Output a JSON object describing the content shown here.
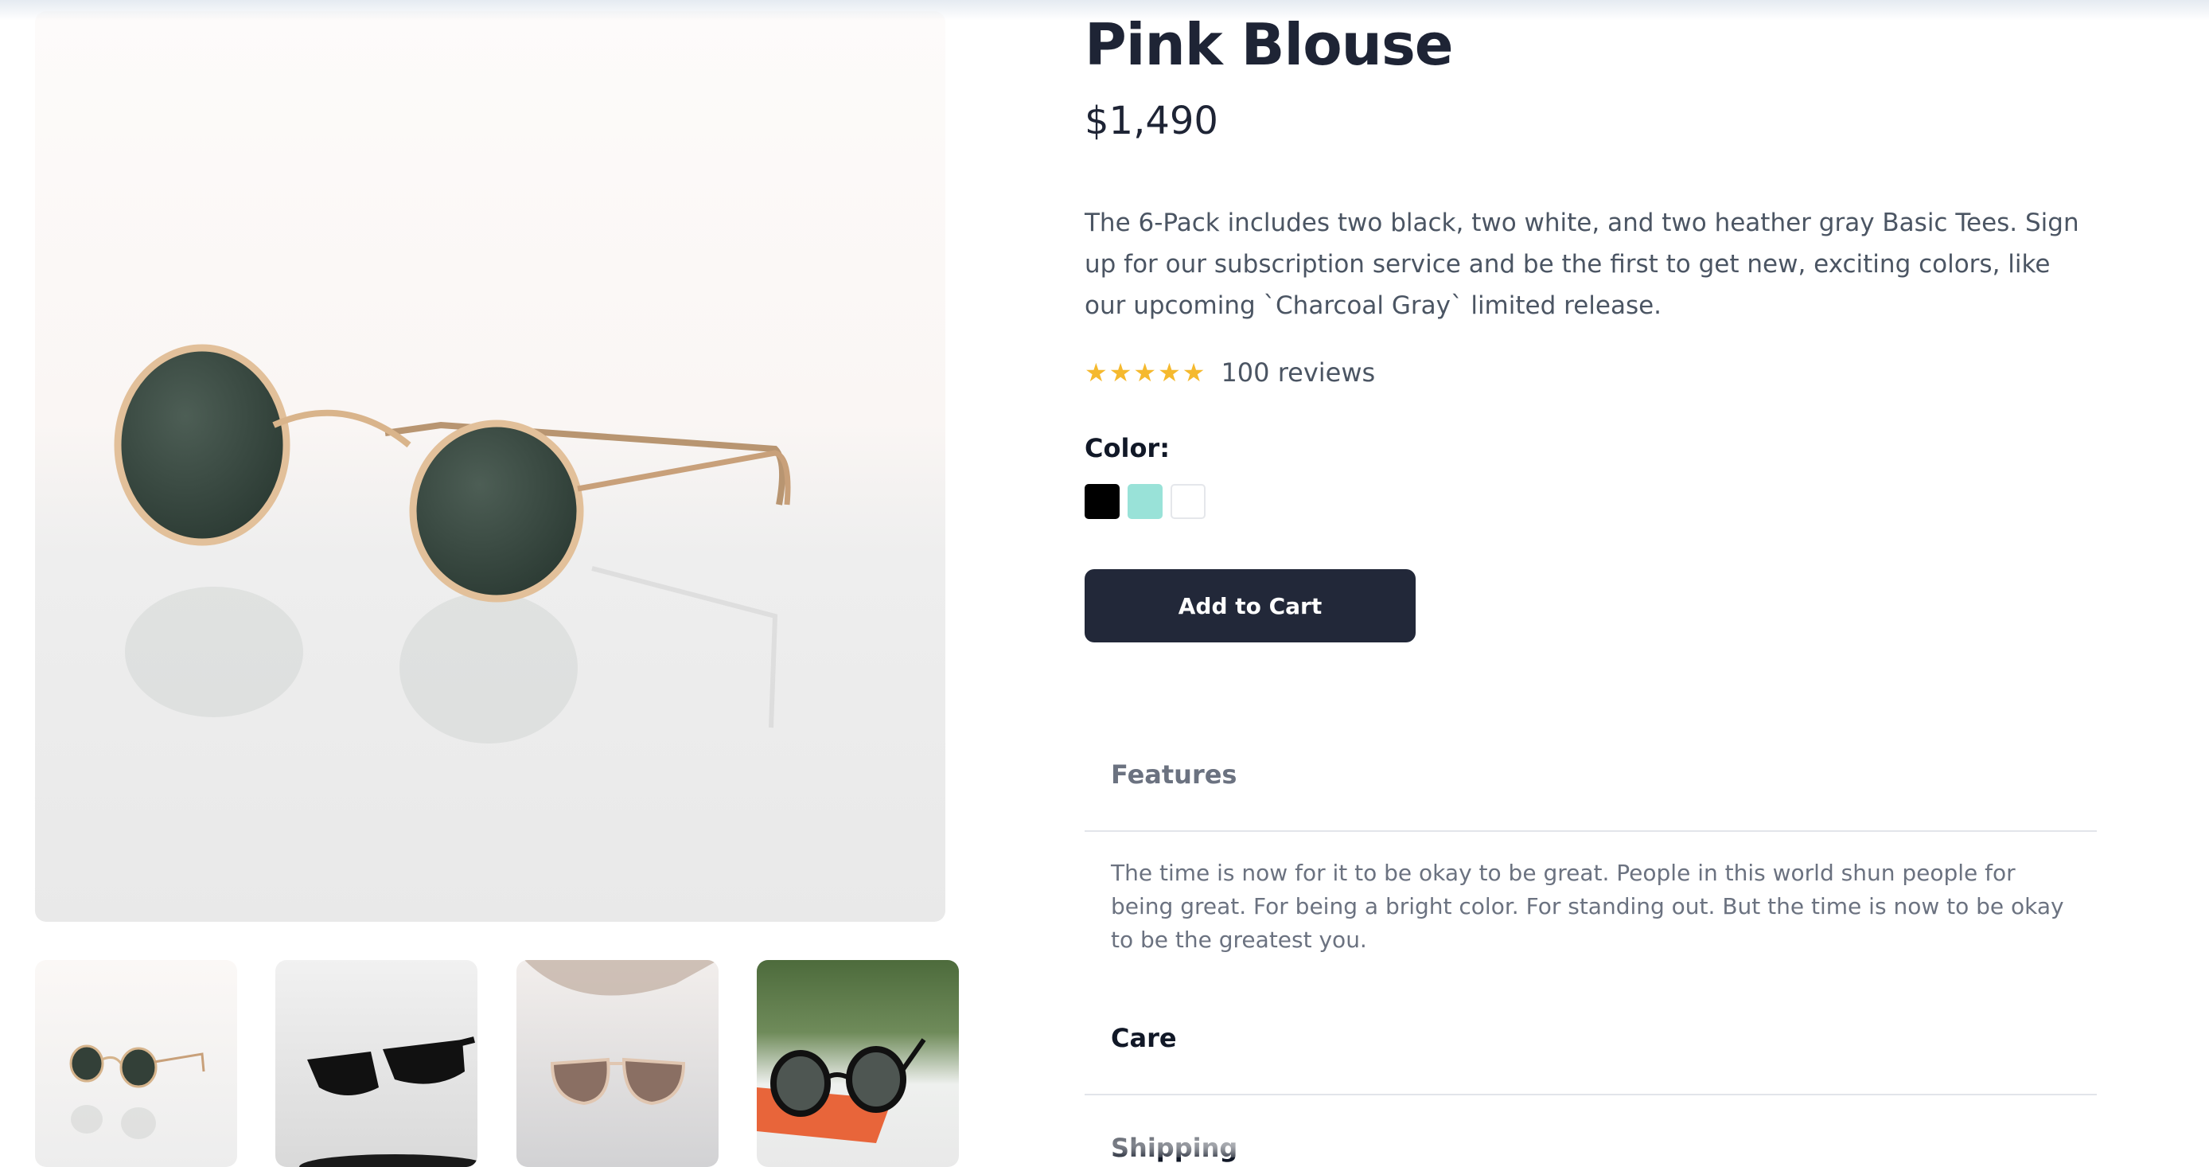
{
  "product": {
    "title": "Pink Blouse",
    "price": "$1,490",
    "description": "The 6-Pack includes two black, two white, and two heather gray Basic Tees. Sign up for our subscription service and be the first to get new, exciting colors, like our upcoming `Charcoal Gray` limited release.",
    "rating": 5,
    "rating_max": 5,
    "reviews_label": "100 reviews"
  },
  "color": {
    "label": "Color:",
    "swatches": [
      "#000000",
      "#99e2d8",
      "#ffffff"
    ]
  },
  "actions": {
    "add_to_cart": "Add to Cart"
  },
  "accordion": {
    "features": {
      "title": "Features",
      "body": "The time is now for it to be okay to be great. People in this world shun people for being great. For being a bright color. For standing out. But the time is now to be okay to be the greatest you."
    },
    "care": {
      "title": "Care"
    },
    "shipping": {
      "title": "Shipping"
    }
  },
  "gallery": {
    "main_image": "round-gold-sunglasses-photo",
    "thumbnails": [
      "round-gold-sunglasses-thumb",
      "black-wayfarer-sunglasses-thumb",
      "tinted-cat-eye-sunglasses-thumb",
      "black-round-sunglasses-on-box-thumb"
    ]
  },
  "colors": {
    "star": "#f5b92e",
    "button_bg": "#222839",
    "text_dark": "#1e2435",
    "text_muted": "#6b7280"
  }
}
